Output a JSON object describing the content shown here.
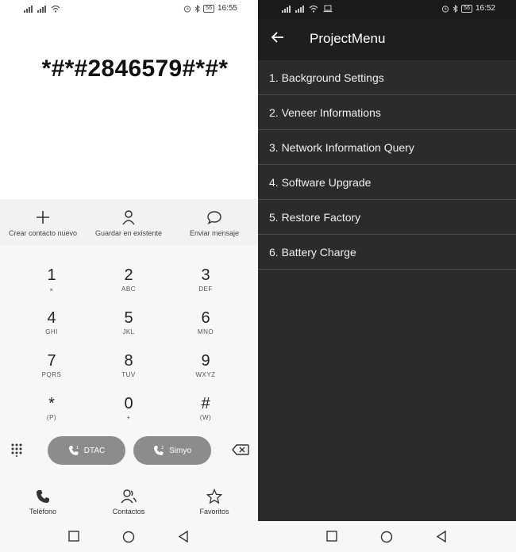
{
  "left_screen": {
    "status_bar": {
      "time": "16:55",
      "battery": "56"
    },
    "dialed_number": "*#*#2846579#*#*",
    "actions": [
      {
        "label": "Crear contacto nuevo",
        "icon": "plus-icon"
      },
      {
        "label": "Guardar en existente",
        "icon": "person-icon"
      },
      {
        "label": "Enviar mensaje",
        "icon": "message-bubble-icon"
      }
    ],
    "keys": [
      {
        "digit": "1",
        "letters": "⌅"
      },
      {
        "digit": "2",
        "letters": "ABC"
      },
      {
        "digit": "3",
        "letters": "DEF"
      },
      {
        "digit": "4",
        "letters": "GHI"
      },
      {
        "digit": "5",
        "letters": "JKL"
      },
      {
        "digit": "6",
        "letters": "MNO"
      },
      {
        "digit": "7",
        "letters": "PQRS"
      },
      {
        "digit": "8",
        "letters": "TUV"
      },
      {
        "digit": "9",
        "letters": "WXYZ"
      },
      {
        "digit": "*",
        "letters": "(P)"
      },
      {
        "digit": "0",
        "letters": "+"
      },
      {
        "digit": "#",
        "letters": "(W)"
      }
    ],
    "call_buttons": [
      {
        "label": "DTAC",
        "sim": "1"
      },
      {
        "label": "Simyo",
        "sim": "2"
      }
    ],
    "bottom_nav": [
      {
        "label": "Teléfono",
        "icon": "phone-icon"
      },
      {
        "label": "Contactos",
        "icon": "contacts-icon"
      },
      {
        "label": "Favoritos",
        "icon": "star-icon"
      }
    ]
  },
  "right_screen": {
    "status_bar": {
      "time": "16:52",
      "battery": "56"
    },
    "title": "ProjectMenu",
    "menu_items": [
      "1. Background Settings",
      "2. Veneer Informations",
      "3. Network Information Query",
      "4. Software Upgrade",
      "5. Restore Factory",
      "6. Battery Charge"
    ]
  },
  "colors": {
    "menu_background": "#2b2b2b",
    "toolbar_background": "#1e1e1e",
    "call_button": "#8c8c8c",
    "dialer_background": "#f7f7f7"
  }
}
